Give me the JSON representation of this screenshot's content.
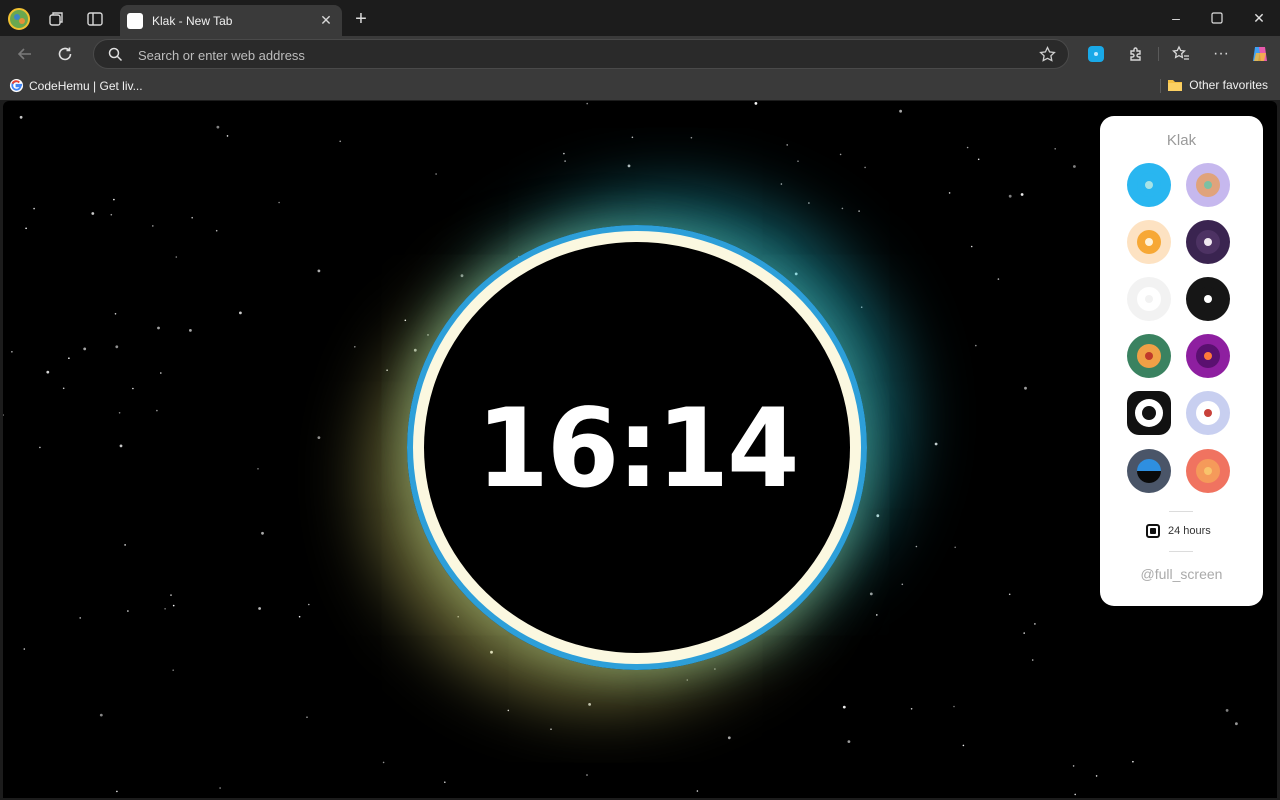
{
  "browser": {
    "tab": {
      "title": "Klak - New Tab",
      "close_glyph": "✕"
    },
    "new_tab_glyph": "+",
    "window_controls": {
      "minimize": "–",
      "maximize": "☐",
      "close": "✕"
    },
    "address_bar": {
      "placeholder": "Search or enter web address",
      "value": ""
    },
    "favorites": [
      {
        "label": "CodeHemu | Get liv...",
        "icon": "google-icon"
      }
    ],
    "other_favorites": {
      "label": "Other favorites",
      "icon": "folder-icon"
    }
  },
  "colors": {
    "ring_outer": "#2d9fd9",
    "ring_inner": "#fbf8e0",
    "glow_left": "#d7d26e",
    "glow_right": "#28bed2",
    "panel_bg": "#ffffff"
  },
  "clock": {
    "time": "16:14"
  },
  "panel": {
    "title": "Klak",
    "themes": [
      {
        "name": "sky",
        "outer": "#29b6f0",
        "mid": "#29b6f0",
        "dot": "#a7e3e6"
      },
      {
        "name": "lavender",
        "outer": "#c6b8ee",
        "mid": "#e0a37c",
        "dot": "#7cc0a3"
      },
      {
        "name": "peach",
        "outer": "#fde2c2",
        "mid": "#f7a835",
        "dot": "#fff2d8"
      },
      {
        "name": "plum",
        "outer": "#3a2450",
        "mid": "#4d3263",
        "dot": "#f0e8f0"
      },
      {
        "name": "white",
        "outer": "#f2f2f2",
        "mid": "#ffffff",
        "dot": "#f2f2f2"
      },
      {
        "name": "black",
        "outer": "#161616",
        "mid": "#161616",
        "dot": "#ffffff"
      },
      {
        "name": "forest",
        "outer": "#3a8260",
        "mid": "#f0a046",
        "dot": "#c0392b"
      },
      {
        "name": "magenta",
        "outer": "#8e1fa0",
        "mid": "#5a1070",
        "dot": "#ff7a3a"
      },
      {
        "name": "mono",
        "outer": "#111111",
        "mid": "#ffffff",
        "dot": "#111111"
      },
      {
        "name": "periwinkle",
        "outer": "#c8cff0",
        "mid": "#ffffff",
        "dot": "#c8413a"
      },
      {
        "name": "ocean",
        "outer": "#4a5568",
        "mid": "#2e8fe0",
        "dot": "#0a0a0a"
      },
      {
        "name": "coral",
        "outer": "#f07360",
        "mid": "#f59a5a",
        "dot": "#f9c36b"
      }
    ],
    "hours_label": "24 hours",
    "hours_enabled": true,
    "fullscreen_label": "@full_screen"
  }
}
